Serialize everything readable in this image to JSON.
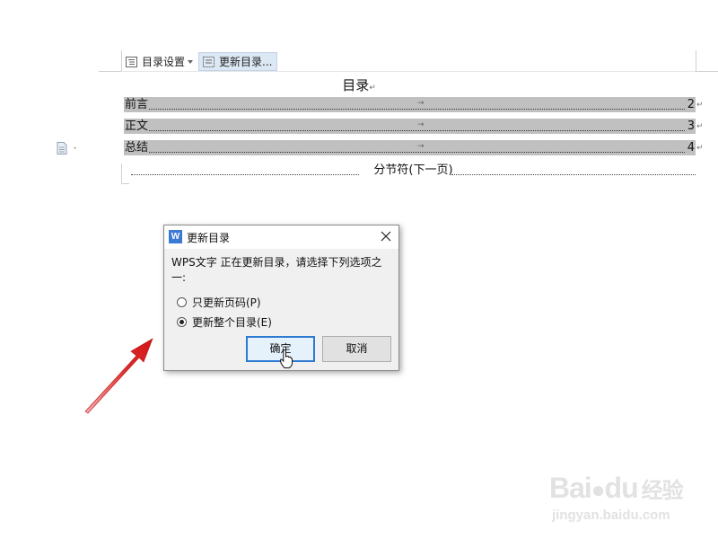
{
  "toc_toolbar": {
    "settings_label": "目录设置",
    "update_label": "更新目录..."
  },
  "document": {
    "toc_title": "目录",
    "entries": [
      {
        "label": "前言",
        "page": "2"
      },
      {
        "label": "正文",
        "page": "3"
      },
      {
        "label": "总结",
        "page": "4"
      }
    ],
    "section_break": "分节符(下一页)"
  },
  "dialog": {
    "title": "更新目录",
    "app_icon": "W",
    "message": "WPS文字 正在更新目录，请选择下列选项之一:",
    "options": [
      {
        "label": "只更新页码(P)",
        "checked": false
      },
      {
        "label": "更新整个目录(E)",
        "checked": true
      }
    ],
    "ok_label": "确定",
    "cancel_label": "取消"
  },
  "watermark": {
    "brand": "Bai",
    "brand_mid": "du",
    "brand_suffix": "经验",
    "url": "jingyan.baidu.com"
  },
  "colors": {
    "toc_highlight": "#c0c0c0",
    "arrow": "#e02020",
    "primary_border": "#2c7ad2",
    "app_icon_bg": "#3a7ad4"
  }
}
